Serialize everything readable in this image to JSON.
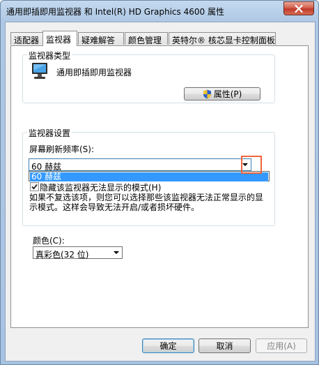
{
  "window": {
    "title": "通用即插即用监视器 和 Intel(R) HD Graphics 4600 属性",
    "close_label": "close"
  },
  "tabs": [
    {
      "label": "适配器",
      "active": false
    },
    {
      "label": "监视器",
      "active": true
    },
    {
      "label": "疑难解答",
      "active": false
    },
    {
      "label": "颜色管理",
      "active": false
    },
    {
      "label": "英特尔® 核芯显卡控制面板",
      "active": false
    }
  ],
  "monitor_type": {
    "group_title": "监视器类型",
    "monitor_name": "通用即插即用监视器",
    "properties_button": "属性(P)",
    "monitor_icon": "monitor-icon",
    "shield_icon": "uac-shield-icon"
  },
  "monitor_settings": {
    "group_title": "监视器设置",
    "refresh_label": "屏幕刷新频率(S):",
    "refresh_value": "60 赫兹",
    "dropdown_options": [
      "60 赫兹"
    ],
    "hide_modes_label": "隐藏该监视器无法显示的模式(H)",
    "hide_modes_checked": true,
    "description": "如果不复选该项，则您可以选择那些该监视器无法正常显示的显示模式。这样会导致无法开启/或者损坏硬件。"
  },
  "colors": {
    "label": "颜色(C):",
    "value": "真彩色(32 位)"
  },
  "footer": {
    "ok": "确定",
    "cancel": "取消",
    "apply": "应用(A)"
  },
  "accent_colors": {
    "highlight": "#3399ff",
    "annotation": "#f0643c",
    "close": "#c0392b"
  }
}
